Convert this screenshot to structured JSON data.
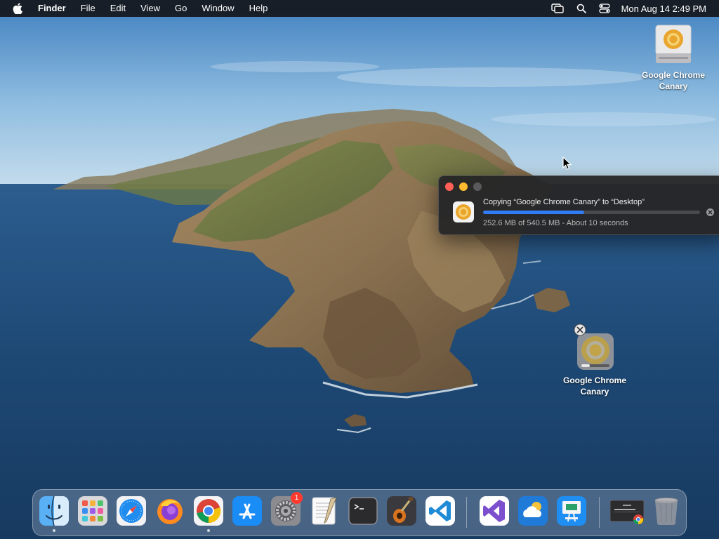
{
  "menubar": {
    "app_name": "Finder",
    "items": [
      "File",
      "Edit",
      "View",
      "Go",
      "Window",
      "Help"
    ],
    "clock": "Mon Aug 14  2:49 PM",
    "status_icons": [
      "screen-mirroring-icon",
      "search-icon",
      "control-center-icon"
    ]
  },
  "desktop": {
    "drive_icon": {
      "label": "Google Chrome Canary",
      "icon": "disk-image-icon"
    },
    "copying_icon": {
      "label": "Google Chrome Canary",
      "icon": "chrome-canary-icon"
    }
  },
  "copy_window": {
    "title": "Copying “Google Chrome Canary” to “Desktop”",
    "status": "252.6 MB of 540.5 MB - About 10 seconds",
    "progress_fraction": 0.467,
    "accent_color": "#2f7cf6"
  },
  "dock": {
    "items": [
      {
        "name": "finder",
        "running": true
      },
      {
        "name": "launchpad",
        "running": false
      },
      {
        "name": "safari",
        "running": false
      },
      {
        "name": "firefox",
        "running": false
      },
      {
        "name": "google-chrome",
        "running": true
      },
      {
        "name": "app-store",
        "running": false
      },
      {
        "name": "system-settings",
        "running": false,
        "badge": "1"
      },
      {
        "name": "textedit",
        "running": false
      },
      {
        "name": "terminal",
        "running": false
      },
      {
        "name": "garageband",
        "running": false
      },
      {
        "name": "visual-studio-code",
        "running": false
      },
      {
        "name": "visual-studio",
        "running": false
      },
      {
        "name": "icloud-weather",
        "running": false
      },
      {
        "name": "keynote",
        "running": false
      },
      {
        "name": "chrome-installer-window",
        "running": false
      },
      {
        "name": "trash",
        "running": false
      }
    ],
    "settings_badge": "1"
  }
}
